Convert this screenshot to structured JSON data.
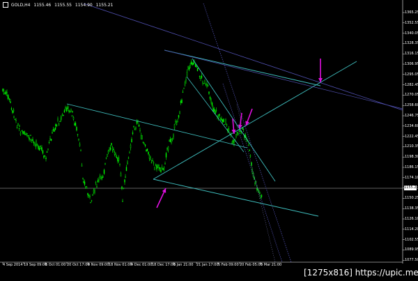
{
  "header": {
    "symbol": "GOLD,H4",
    "open": "1155.46",
    "high": "1155.55",
    "low": "1154.90",
    "close": "1155.21"
  },
  "current_price": "1155.21",
  "price_axis": [
    "1365.25",
    "1352.55",
    "1340.05",
    "1328.35",
    "1316.15",
    "1306.95",
    "1295.05",
    "1282.45",
    "1270.05",
    "1258.60",
    "1246.75",
    "1234.60",
    "1222.45",
    "1210.35",
    "1198.30",
    "1186.15",
    "1174.10",
    "1162.45",
    "1150.25",
    "1138.35",
    "1126.10",
    "1114.20",
    "1102.55",
    "1089.95",
    "1077.50"
  ],
  "time_axis": [
    "4 Sep 2014",
    "19 Sep 09:00",
    "6 Oct 01:00",
    "20 Oct 17:00",
    "4 Nov 09:00",
    "18 Nov 01:00",
    "4 Dec 01:00",
    "18 Dec 17:00",
    "6 Jan 21:00",
    "21 Jan 17:00",
    "5 Feb 09:00",
    "20 Feb 05:00",
    "5 Mar 21:00"
  ],
  "colors": {
    "background": "#000000",
    "candle": "#00ff00",
    "channel": "#3fbfbf",
    "trendline": "#5050b0",
    "arrow": "#e010e0",
    "price_line": "#c0c0c0"
  },
  "icons": [
    "chart-header-marker-icon",
    "annotation-arrow-icon"
  ],
  "watermark": "[1275x816] https://upic.me/"
}
